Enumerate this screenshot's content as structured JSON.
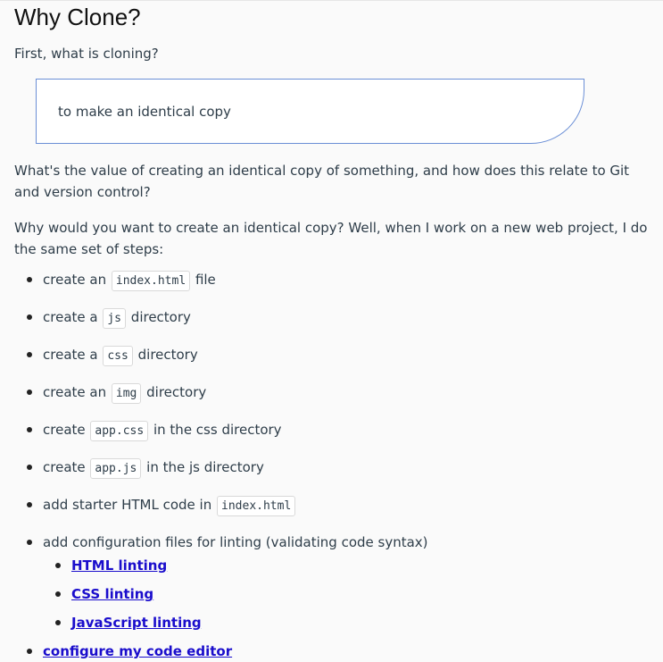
{
  "heading": "Why Clone?",
  "intro": "First, what is cloning?",
  "definition": "to make an identical copy",
  "paragraph1": "What's the value of creating an identical copy of something, and how does this relate to Git and version control?",
  "paragraph2": "Why would you want to create an identical copy? Well, when I work on a new web project, I do the same set of steps:",
  "steps": [
    {
      "before": "create an",
      "code": "index.html",
      "after": "file"
    },
    {
      "before": "create a",
      "code": "js",
      "after": "directory"
    },
    {
      "before": "create a",
      "code": "css",
      "after": "directory"
    },
    {
      "before": "create an",
      "code": "img",
      "after": "directory"
    },
    {
      "before": "create",
      "code": "app.css",
      "after": "in the css directory"
    },
    {
      "before": "create",
      "code": "app.js",
      "after": "in the js directory"
    },
    {
      "before": "add starter HTML code in",
      "code": "index.html",
      "after": ""
    }
  ],
  "config_step": {
    "text": "add configuration files for linting (validating code syntax)",
    "links": [
      "HTML linting",
      "CSS linting",
      "JavaScript linting"
    ]
  },
  "editor_link": "configure my code editor"
}
